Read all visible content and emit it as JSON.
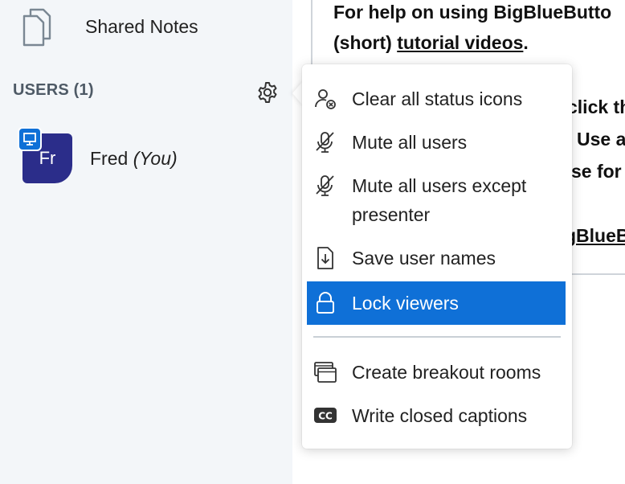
{
  "sidebar": {
    "notes_label": "Shared Notes",
    "users_title": "USERS (1)",
    "user": {
      "initials": "Fr",
      "name": "Fred",
      "you_label": "(You)"
    }
  },
  "presentation": {
    "line1": "For help on using BigBlueButto",
    "line2_prefix": "(short) ",
    "line2_link": "tutorial videos",
    "line2_suffix": ".",
    "line3": "click th",
    "line4": "Use a",
    "line5": "se for c",
    "line6": "gBlueB"
  },
  "menu": {
    "items": [
      {
        "label": "Clear all status icons",
        "icon": "clear-status-icon"
      },
      {
        "label": "Mute all users",
        "icon": "mute-icon"
      },
      {
        "label": "Mute all users except presenter",
        "icon": "mute-icon"
      },
      {
        "label": "Save user names",
        "icon": "download-file-icon"
      },
      {
        "label": "Lock viewers",
        "icon": "lock-icon"
      },
      {
        "label": "Create breakout rooms",
        "icon": "breakout-rooms-icon"
      },
      {
        "label": "Write closed captions",
        "icon": "closed-captions-icon"
      }
    ],
    "active_color": "#0f70d7"
  }
}
